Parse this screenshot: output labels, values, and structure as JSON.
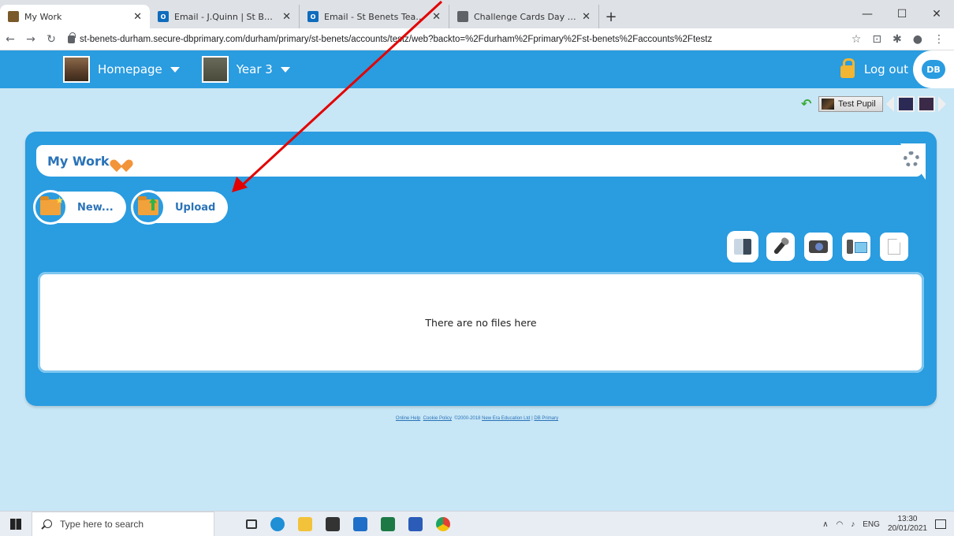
{
  "browser": {
    "tabs": [
      {
        "title": "My Work",
        "active": true
      },
      {
        "title": "Email - J.Quinn | St Benet's RCVA",
        "active": false
      },
      {
        "title": "Email - St Benets Teachers - Outl",
        "active": false
      },
      {
        "title": "Challenge Cards Day 4.pdf",
        "active": false
      }
    ],
    "url": "st-benets-durham.secure-dbprimary.com/durham/primary/st-benets/accounts/testz/web?backto=%2Fdurham%2Fprimary%2Fst-benets%2Faccounts%2Ftestz"
  },
  "appbar": {
    "home_label": "Homepage",
    "class_label": "Year 3",
    "logout_label": "Log out",
    "logo_text": "DB"
  },
  "switcher": {
    "user_name": "Test Pupil"
  },
  "panel": {
    "title": "My Work",
    "new_label": "New...",
    "upload_label": "Upload",
    "empty_message": "There are no files here"
  },
  "footer": {
    "online_help": "Online Help",
    "cookie_policy": "Cookie Policy",
    "copyright": "©2000-2018",
    "company": "New Era Education Ltd",
    "separator": "|",
    "db_primary": "DB Primary"
  },
  "taskbar": {
    "search_placeholder": "Type here to search",
    "language": "ENG",
    "time": "13:30",
    "date": "20/01/2021"
  },
  "colors": {
    "accent": "#2a9ce0",
    "background": "#c7e6f6",
    "annotation_arrow": "#e30000"
  }
}
